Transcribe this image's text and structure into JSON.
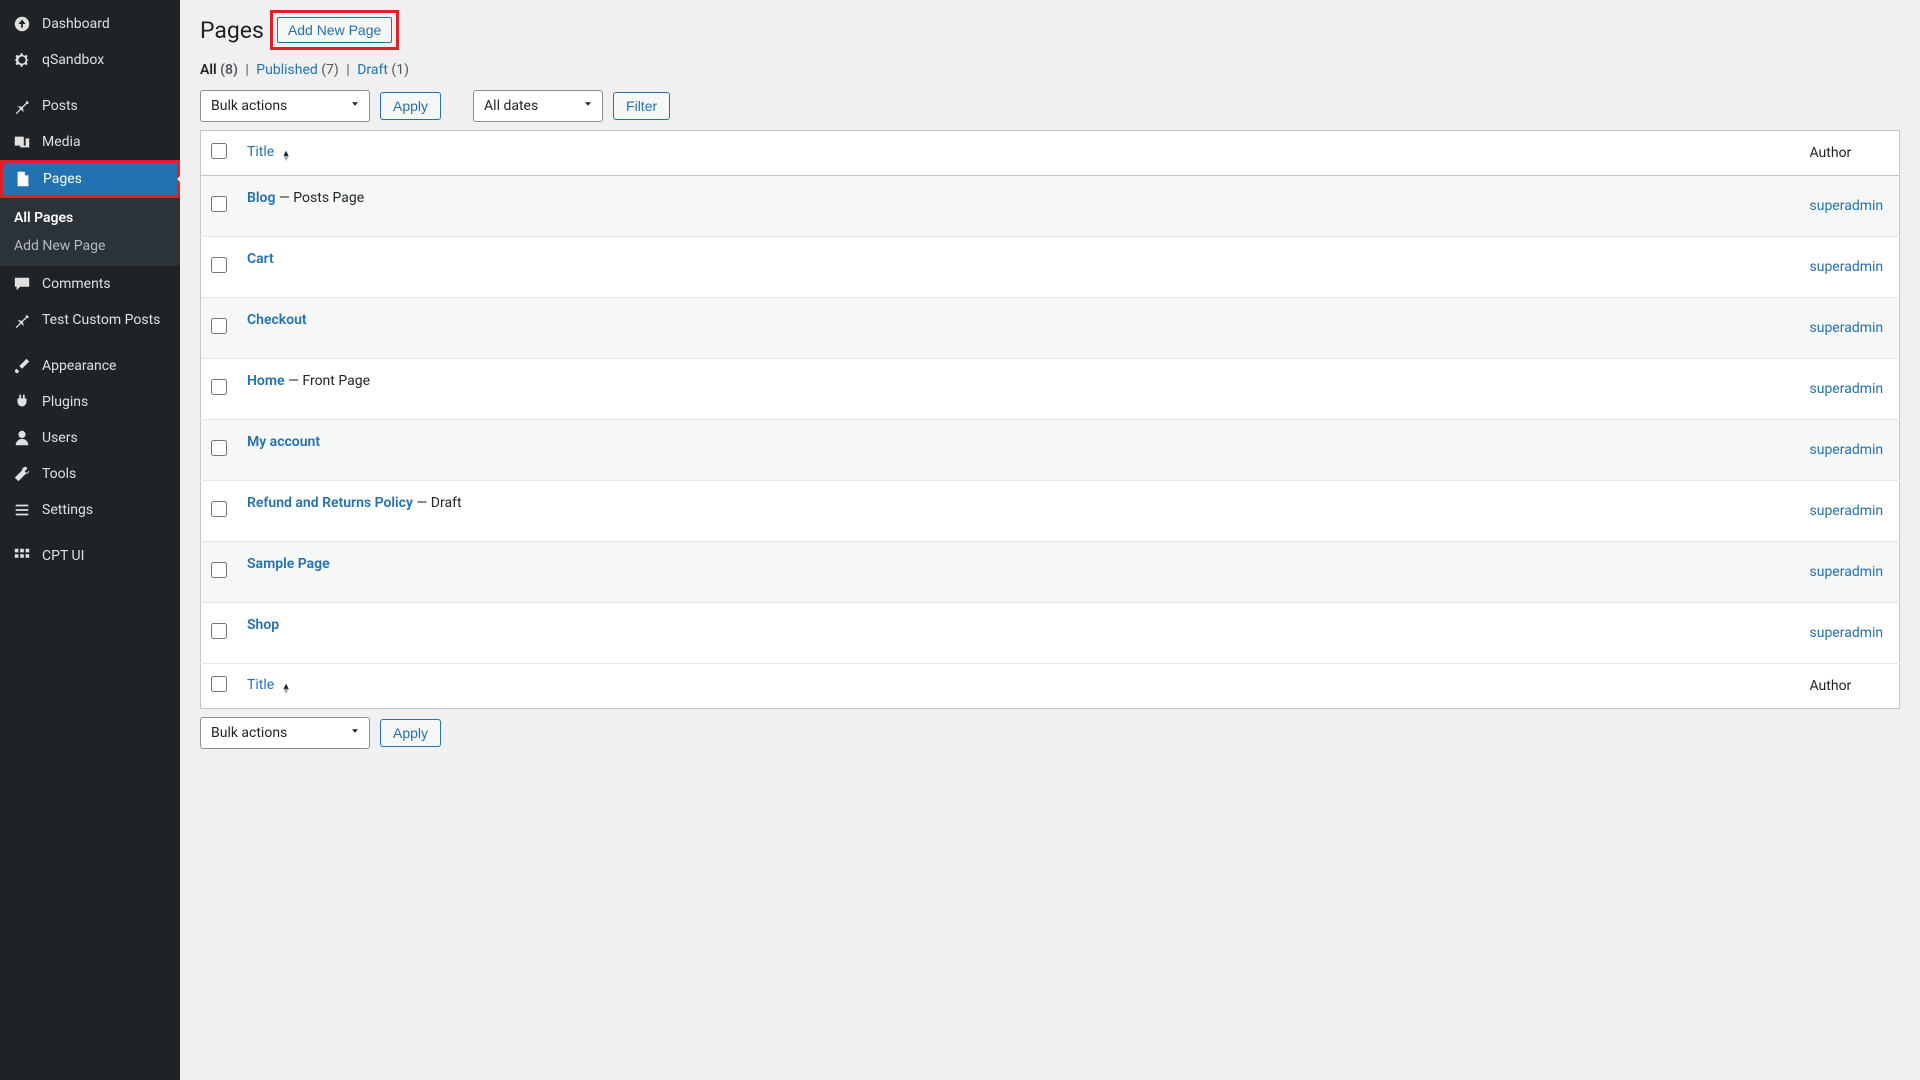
{
  "sidebar": {
    "items": [
      {
        "icon": "dashboard-icon",
        "label": "Dashboard"
      },
      {
        "icon": "gear-icon",
        "label": "qSandbox"
      },
      {
        "sep": true
      },
      {
        "icon": "pin-icon",
        "label": "Posts"
      },
      {
        "icon": "media-icon",
        "label": "Media"
      },
      {
        "icon": "page-icon",
        "label": "Pages",
        "active": true
      },
      {
        "icon": "comment-icon",
        "label": "Comments"
      },
      {
        "icon": "pin-icon",
        "label": "Test Custom Posts"
      },
      {
        "sep": true
      },
      {
        "icon": "brush-icon",
        "label": "Appearance"
      },
      {
        "icon": "plug-icon",
        "label": "Plugins"
      },
      {
        "icon": "user-icon",
        "label": "Users"
      },
      {
        "icon": "wrench-icon",
        "label": "Tools"
      },
      {
        "icon": "sliders-icon",
        "label": "Settings"
      },
      {
        "sep": true
      },
      {
        "icon": "grid-icon",
        "label": "CPT UI"
      }
    ],
    "submenu": [
      {
        "label": "All Pages",
        "current": true
      },
      {
        "label": "Add New Page"
      }
    ]
  },
  "header": {
    "title": "Pages",
    "add_new_label": "Add New Page"
  },
  "filters": {
    "all_label": "All",
    "all_count": "(8)",
    "published_label": "Published",
    "published_count": "(7)",
    "draft_label": "Draft",
    "draft_count": "(1)",
    "bulk_actions_label": "Bulk actions",
    "apply_label": "Apply",
    "all_dates_label": "All dates",
    "filter_label": "Filter"
  },
  "table": {
    "title_col": "Title",
    "author_col": "Author",
    "rows": [
      {
        "title": "Blog",
        "suffix": " — Posts Page",
        "author": "superadmin"
      },
      {
        "title": "Cart",
        "suffix": "",
        "author": "superadmin"
      },
      {
        "title": "Checkout",
        "suffix": "",
        "author": "superadmin"
      },
      {
        "title": "Home",
        "suffix": " — Front Page",
        "author": "superadmin"
      },
      {
        "title": "My account",
        "suffix": "",
        "author": "superadmin"
      },
      {
        "title": "Refund and Returns Policy",
        "suffix": " — Draft",
        "author": "superadmin"
      },
      {
        "title": "Sample Page",
        "suffix": "",
        "author": "superadmin"
      },
      {
        "title": "Shop",
        "suffix": "",
        "author": "superadmin"
      }
    ]
  }
}
